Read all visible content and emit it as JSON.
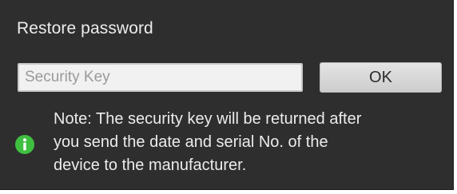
{
  "dialog": {
    "title": "Restore password",
    "security_key": {
      "value": "",
      "placeholder": "Security Key"
    },
    "ok_label": "OK",
    "note": {
      "icon": "info-icon",
      "lines": [
        "Note: The security key will be returned after",
        "you send the date and serial No. of the",
        "device to the manufacturer."
      ]
    }
  },
  "colors": {
    "dialog_background": "#2e2e2e",
    "text": "#ececec",
    "info_icon": "#3fbf3f",
    "input_background": "#f1f1f1",
    "button_background": "#d8d8d8"
  }
}
